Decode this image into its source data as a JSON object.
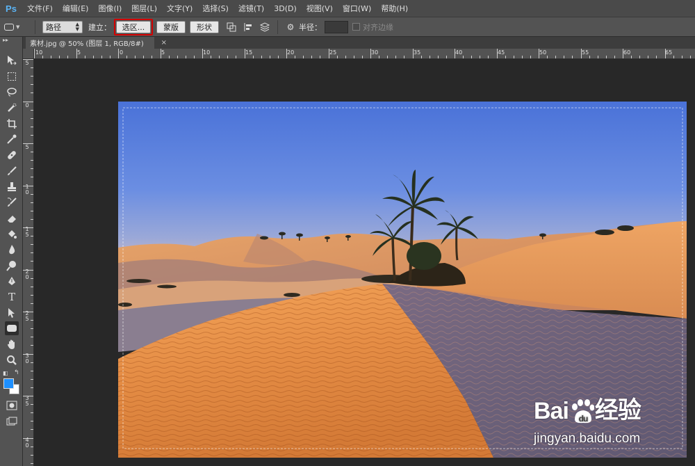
{
  "app": {
    "logo": "Ps"
  },
  "menu": [
    {
      "label": "文件(F)"
    },
    {
      "label": "编辑(E)"
    },
    {
      "label": "图像(I)"
    },
    {
      "label": "图层(L)"
    },
    {
      "label": "文字(Y)"
    },
    {
      "label": "选择(S)"
    },
    {
      "label": "滤镜(T)"
    },
    {
      "label": "3D(D)"
    },
    {
      "label": "视图(V)"
    },
    {
      "label": "窗口(W)"
    },
    {
      "label": "帮助(H)"
    }
  ],
  "options": {
    "mode_select": "路径",
    "make_label": "建立：",
    "selection_button": "选区...",
    "mask_button": "蒙版",
    "shape_button": "形状",
    "radius_label": "半径：",
    "radius_value": "",
    "align_edges_label": "对齐边缘",
    "align_edges_checked": false
  },
  "document": {
    "tab_title": "素材.jpg @ 50% (图层 1, RGB/8#)",
    "close_glyph": "×"
  },
  "rulers": {
    "horizontal": [
      "10",
      "5",
      "0",
      "5",
      "10",
      "15",
      "20",
      "25",
      "30",
      "35",
      "40",
      "45",
      "50",
      "55",
      "60",
      "65"
    ],
    "vertical": [
      "5",
      "0",
      "5",
      "1\n0",
      "1\n5",
      "2\n0",
      "2\n5",
      "3\n0",
      "3\n5",
      "4\n0"
    ]
  },
  "tools": [
    "move-tool-icon",
    "marquee-tool-icon",
    "lasso-tool-icon",
    "quick-select-tool-icon",
    "crop-tool-icon",
    "eyedropper-tool-icon",
    "healing-brush-tool-icon",
    "brush-tool-icon",
    "stamp-tool-icon",
    "history-brush-tool-icon",
    "eraser-tool-icon",
    "paint-bucket-tool-icon",
    "blur-tool-icon",
    "dodge-tool-icon",
    "pen-tool-icon",
    "type-tool-icon",
    "path-select-tool-icon",
    "rounded-rect-tool-icon",
    "hand-tool-icon",
    "zoom-tool-icon",
    "quick-mask-icon",
    "screen-mode-icon"
  ],
  "colors": {
    "foreground": "#1e90ff",
    "background": "#ffffff",
    "annotation": "#d40000"
  },
  "watermark": {
    "brand_left": "Bai",
    "brand_right": "经验",
    "url": "jingyan.baidu.com"
  }
}
